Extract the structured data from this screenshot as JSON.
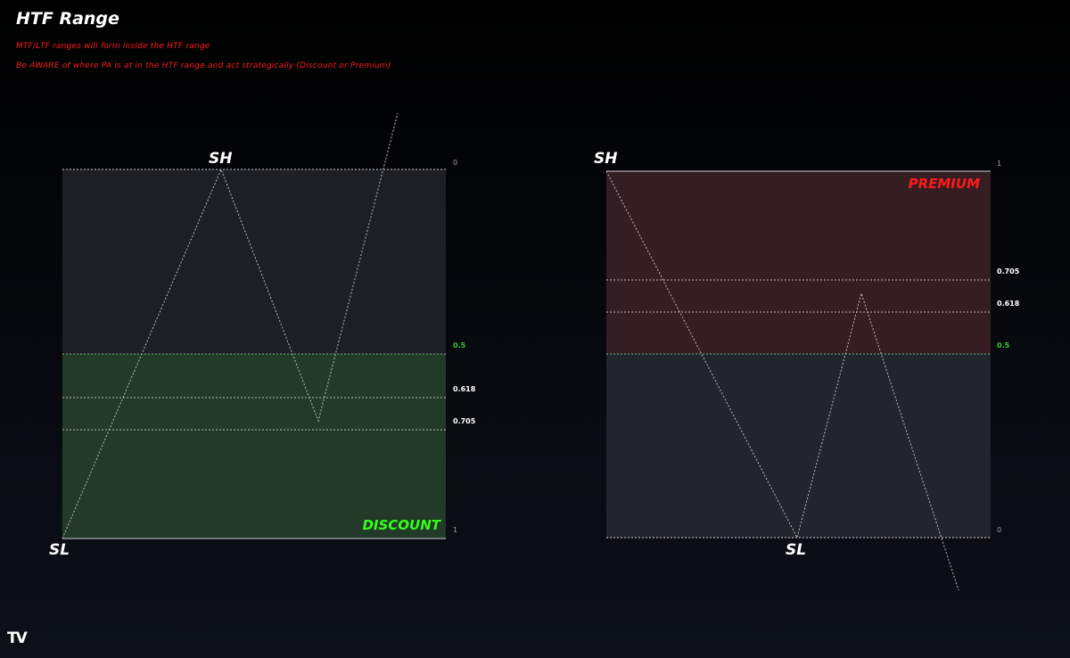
{
  "title": "HTF Range",
  "notes": [
    "MTF/LTF ranges will form inside the HTF range",
    "Be AWARE of where PA is at in the HTF range and act strategically (Discount or Premium)"
  ],
  "logo": "TV",
  "colors": {
    "notes": "#ff1a1a",
    "discount": "#33ff1a",
    "premium": "#ff1a1a",
    "level_mid": "#33cc33",
    "level_text": "#ffffff",
    "edge_text": "#9aa0a6"
  },
  "left_diagram": {
    "high_label": "SH",
    "low_label": "SL",
    "zone_label": "DISCOUNT",
    "level_top": "0",
    "level_bottom": "1",
    "level_mid": "0.5",
    "level_a": "0.618",
    "level_b": "0.705"
  },
  "right_diagram": {
    "high_label": "SH",
    "low_label": "SL",
    "zone_label": "PREMIUM",
    "level_top": "1",
    "level_bottom": "0",
    "level_mid": "0.5",
    "level_a": "0.705",
    "level_b": "0.618"
  }
}
